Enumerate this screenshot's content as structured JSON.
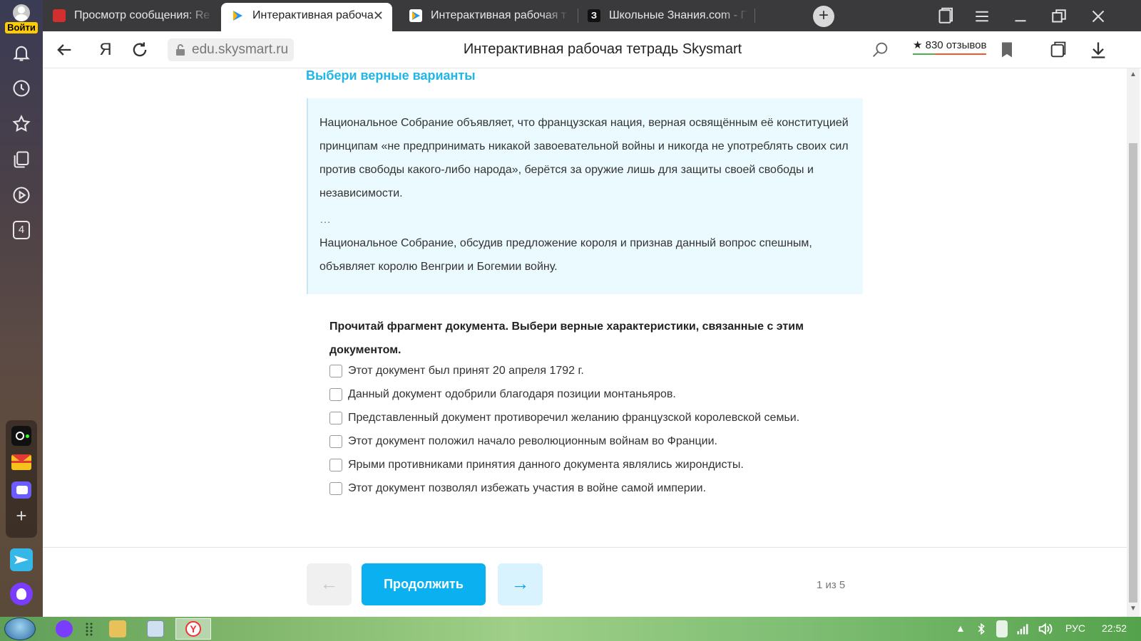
{
  "sidebar": {
    "login_label": "Войти",
    "counter_badge": "4"
  },
  "tabs": [
    {
      "title": "Просмотр сообщения: Re",
      "favicon": "red-mail",
      "active": false
    },
    {
      "title": "Интерактивная рабоча",
      "favicon": "skysmart-play",
      "active": true
    },
    {
      "title": "Интерактивная рабочая т",
      "favicon": "skysmart-play",
      "active": false
    },
    {
      "title": "Школьные Знания.com - Г",
      "favicon": "znania",
      "active": false
    }
  ],
  "toolbar": {
    "yandex_glyph": "Я",
    "url": "edu.skysmart.ru",
    "page_title": "Интерактивная рабочая тетрадь Skysmart",
    "reviews": "★ 830 отзывов"
  },
  "content": {
    "task_heading": "Выбери верные варианты",
    "doc_paragraph_1": "Национальное Собрание объявляет, что французская нация, верная освящённым её конституцией принципам «не предпринимать никакой завоевательной войны и никогда не употреблять своих сил против свободы какого-либо народа», берётся за оружие лишь для защиты своей свободы и независимости.",
    "doc_ellipsis": "…",
    "doc_paragraph_2": "Национальное Собрание, обсудив предложение короля и признав данный вопрос спешным, объявляет королю Венгрии и Богемии войну.",
    "question": "Прочитай фрагмент документа. Выбери верные характеристики, связанные с этим документом.",
    "options": [
      "Этот документ был принят 20 апреля 1792 г.",
      "Данный документ одобрили благодаря позиции монтаньяров.",
      "Представленный документ противоречил желанию французской королевской семьи.",
      "Этот документ положил начало революционным войнам во Франции.",
      "Ярыми противниками принятия данного документа являлись жирондисты.",
      "Этот документ позволял избежать участия в войне самой империи."
    ]
  },
  "footer": {
    "prev_arrow": "←",
    "continue_label": "Продолжить",
    "next_arrow": "→",
    "pager": "1 из 5"
  },
  "taskbar": {
    "lang": "РУС",
    "time": "22:52"
  },
  "colors": {
    "accent": "#0ab0f0",
    "heading": "#20b6e6",
    "doc_bg": "#eafaff"
  }
}
